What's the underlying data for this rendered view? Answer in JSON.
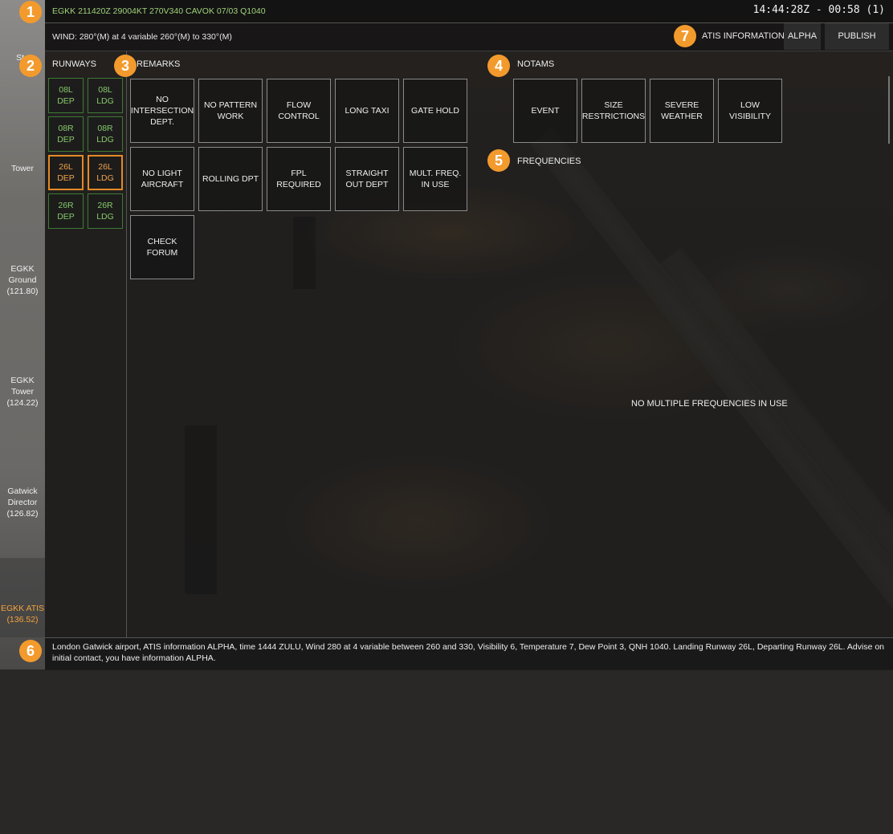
{
  "header": {
    "metar": "EGKK 211420Z 29004KT 270V340 CAVOK 07/03 Q1040",
    "clock": "14:44:28Z - 00:58 (1)",
    "wind": "WIND: 280°(M) at 4 variable 260°(M) to 330°(M)",
    "atis_information_label": "ATIS INFORMATION",
    "atis_letter_button": "ALPHA",
    "publish_button": "PUBLISH"
  },
  "sidebar": {
    "items": [
      {
        "label": "Sta"
      },
      {
        "label": "Tower"
      },
      {
        "label": "EGKK Ground (121.80)"
      },
      {
        "label": "EGKK Tower (124.22)"
      },
      {
        "label": "Gatwick Director (126.82)"
      },
      {
        "label": "EGKK ATIS (136.52)"
      }
    ]
  },
  "sections": {
    "runways": "RUNWAYS",
    "remarks": "REMARKS",
    "notams": "NOTAMS",
    "frequencies": "FREQUENCIES"
  },
  "runways": [
    {
      "line1": "08L",
      "line2": "DEP",
      "active": false
    },
    {
      "line1": "08L",
      "line2": "LDG",
      "active": false
    },
    {
      "line1": "08R",
      "line2": "DEP",
      "active": false
    },
    {
      "line1": "08R",
      "line2": "LDG",
      "active": false
    },
    {
      "line1": "26L",
      "line2": "DEP",
      "active": true
    },
    {
      "line1": "26L",
      "line2": "LDG",
      "active": true
    },
    {
      "line1": "26R",
      "line2": "DEP",
      "active": false
    },
    {
      "line1": "26R",
      "line2": "LDG",
      "active": false
    }
  ],
  "remarks": [
    "NO INTERSECTION DEPT.",
    "NO PATTERN WORK",
    "FLOW CONTROL",
    "LONG TAXI",
    "GATE HOLD",
    "NO LIGHT AIRCRAFT",
    "ROLLING DPT",
    "FPL REQUIRED",
    "STRAIGHT OUT DEPT",
    "MULT. FREQ. IN USE",
    "CHECK FORUM"
  ],
  "notams": [
    "EVENT",
    "SIZE RESTRICTIONS",
    "SEVERE WEATHER",
    "LOW VISIBILITY"
  ],
  "frequencies_status": "NO MULTIPLE FREQUENCIES IN USE",
  "atis_text": "London Gatwick  airport, ATIS information ALPHA, time 1444 ZULU, Wind 280 at 4  variable between 260 and 330, Visibility 6, Temperature 7, Dew Point 3, QNH 1040. Landing Runway 26L, Departing Runway 26L. Advise on initial contact, you have information ALPHA.",
  "markers": [
    "1",
    "2",
    "3",
    "4",
    "5",
    "6",
    "7"
  ],
  "colors": {
    "accent": "#f39a2d",
    "active_runway": "#e48a25",
    "runway_text": "#86c96a",
    "metar_text": "#9fd37a"
  }
}
